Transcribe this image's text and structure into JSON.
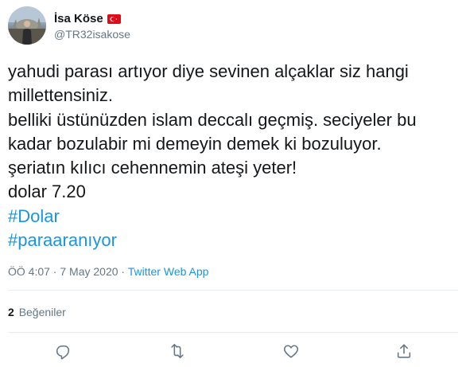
{
  "user": {
    "display_name": "İsa Köse",
    "handle": "@TR32isakose",
    "flag_icon": "turkey-flag-icon"
  },
  "tweet": {
    "lines": [
      "yahudi parası artıyor diye sevinen alçaklar siz hangi",
      "millettensiniz.",
      "belliki üstünüzden islam deccalı geçmiş. seciyeler bu",
      "kadar bozulabir mi demeyin demek ki bozuluyor.",
      "şeriatın kılıcı cehennemin ateşi yeter!",
      "dolar 7.20"
    ],
    "hashtags": [
      "#Dolar",
      "#paraaranıyor"
    ]
  },
  "meta": {
    "timestamp": "ÖÖ 4:07 · 7 May 2020",
    "separator": " · ",
    "source": "Twitter Web App"
  },
  "stats": {
    "likes_count": "2",
    "likes_label": "Beğeniler"
  },
  "actions": [
    {
      "name": "reply",
      "icon": "reply-icon"
    },
    {
      "name": "retweet",
      "icon": "retweet-icon"
    },
    {
      "name": "like",
      "icon": "heart-icon"
    },
    {
      "name": "share",
      "icon": "share-icon"
    }
  ],
  "colors": {
    "link": "#1b95e0",
    "secondary": "#657786",
    "text": "#14171a",
    "divider": "#e6ecf0"
  }
}
